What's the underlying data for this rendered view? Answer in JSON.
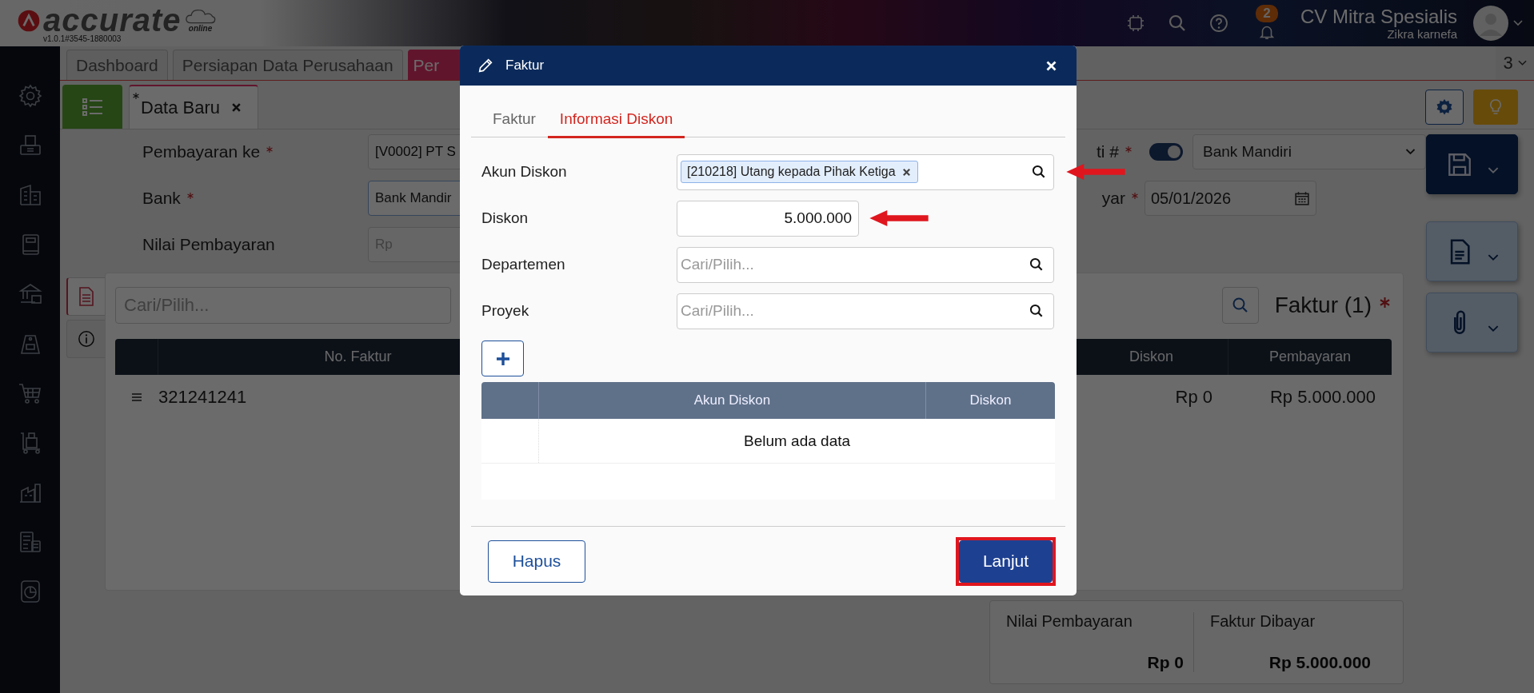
{
  "app": {
    "logo": "accurate",
    "logo_sub": "online",
    "version": "v1.0.1#3545-1880003",
    "notifications": "2",
    "company": "CV Mitra Spesialis",
    "user": "Zikra karnefa"
  },
  "tabs": [
    {
      "label": "Dashboard",
      "selected": false
    },
    {
      "label": "Persiapan Data Perusahaan",
      "selected": false
    },
    {
      "label": "Per",
      "selected": true
    }
  ],
  "tab_count": "3",
  "doc_tab": {
    "label": "Data Baru",
    "modified": true
  },
  "form_left": [
    {
      "label": "Pembayaran ke",
      "required": true,
      "value": "[V0002] PT S"
    },
    {
      "label": "Bank",
      "required": true,
      "value": "Bank Mandir"
    },
    {
      "label": "Nilai Pembayaran",
      "required": false,
      "placeholder": "Rp"
    }
  ],
  "form_right": [
    {
      "label": "ti #",
      "required": true,
      "kind": "toggle-select",
      "on": true,
      "value": "Bank Mandiri"
    },
    {
      "label": "yar",
      "required": true,
      "kind": "date",
      "value": "05/01/2026"
    }
  ],
  "panel": {
    "side_tabs": [
      {
        "kind": "document",
        "selected": true
      },
      {
        "kind": "info",
        "selected": false
      }
    ],
    "search": {
      "placeholder": "Cari/Pilih..."
    },
    "title": "Faktur (1)",
    "required": true,
    "columns_left": [
      "No. Faktur"
    ],
    "columns_right": [
      "Diskon",
      "Pembayaran"
    ],
    "rows": [
      {
        "no": "321241241",
        "diskon": "Rp 0",
        "pembayaran": "Rp 5.000.000"
      }
    ]
  },
  "summary": [
    {
      "label": "Nilai Pembayaran",
      "value": "Rp 0"
    },
    {
      "label": "Faktur Dibayar",
      "value": "Rp 5.000.000"
    }
  ],
  "dialog": {
    "title": "Faktur",
    "tabs": [
      {
        "label": "Faktur",
        "selected": false
      },
      {
        "label": "Informasi Diskon",
        "selected": true
      }
    ],
    "fields": [
      {
        "label": "Akun Diskon",
        "kind": "tag-search",
        "tag": "[210218] Utang kepada Pihak Ketiga",
        "highlighted": true
      },
      {
        "label": "Diskon",
        "kind": "number",
        "value": "5.000.000",
        "highlighted": true
      },
      {
        "label": "Departemen",
        "kind": "search",
        "placeholder": "Cari/Pilih...",
        "highlighted": false
      },
      {
        "label": "Proyek",
        "kind": "search",
        "placeholder": "Cari/Pilih...",
        "highlighted": false
      }
    ],
    "table": {
      "columns": [
        "Akun Diskon",
        "Diskon"
      ],
      "empty_text": "Belum ada data"
    },
    "buttons": [
      {
        "label": "Hapus",
        "kind": "secondary",
        "highlighted": false
      },
      {
        "label": "Lanjut",
        "kind": "primary",
        "highlighted": true
      }
    ]
  }
}
